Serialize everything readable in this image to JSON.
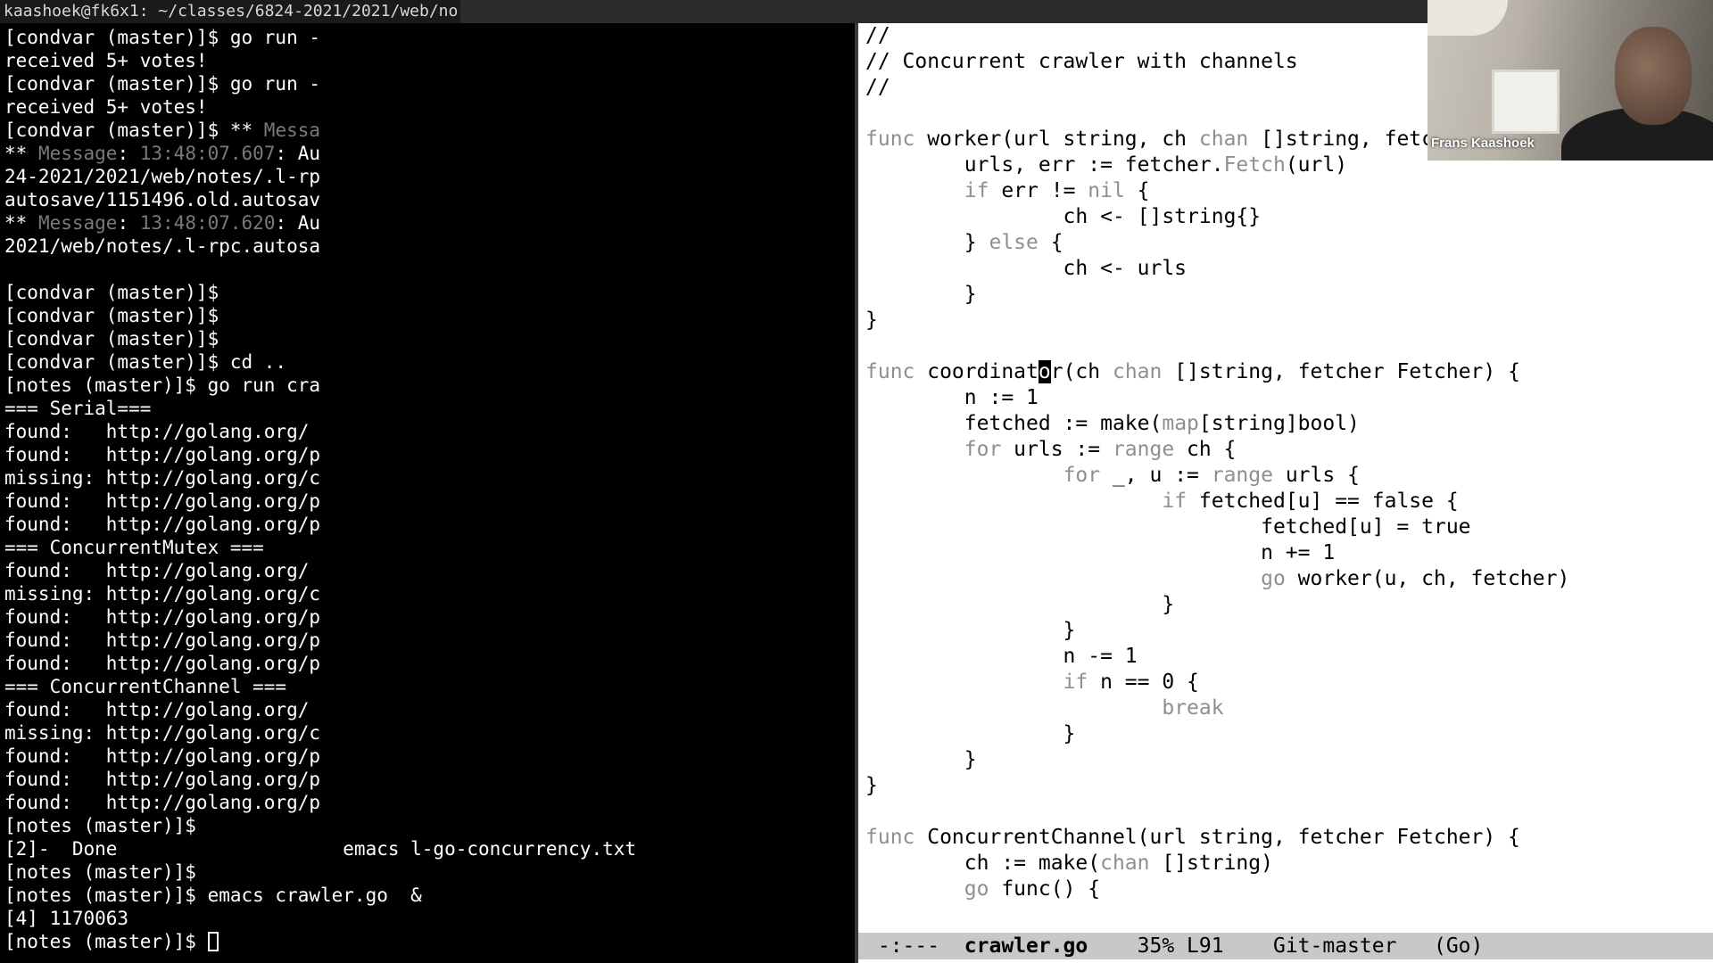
{
  "terminal": {
    "title": "kaashoek@fk6x1: ~/classes/6824-2021/2021/web/no",
    "lines": [
      [
        {
          "t": "[condvar (master)]$ go run -"
        }
      ],
      [
        {
          "t": "received 5+ votes!"
        }
      ],
      [
        {
          "t": "[condvar (master)]$ go run -"
        }
      ],
      [
        {
          "t": "received 5+ votes!"
        }
      ],
      [
        {
          "t": "[condvar (master)]$ ** "
        },
        {
          "t": "Messa",
          "c": "dim"
        }
      ],
      [
        {
          "t": "** "
        },
        {
          "t": "Message",
          "c": "dim"
        },
        {
          "t": ": "
        },
        {
          "t": "13:48:07.607",
          "c": "dim"
        },
        {
          "t": ": Au"
        }
      ],
      [
        {
          "t": "24-2021/2021/web/notes/.l-rp"
        }
      ],
      [
        {
          "t": "autosave/1151496.old.autosav"
        }
      ],
      [
        {
          "t": "** "
        },
        {
          "t": "Message",
          "c": "dim"
        },
        {
          "t": ": "
        },
        {
          "t": "13:48:07.620",
          "c": "dim"
        },
        {
          "t": ": Au"
        }
      ],
      [
        {
          "t": "2021/web/notes/.l-rpc.autosa"
        }
      ],
      [
        {
          "t": ""
        }
      ],
      [
        {
          "t": "[condvar (master)]$"
        }
      ],
      [
        {
          "t": "[condvar (master)]$"
        }
      ],
      [
        {
          "t": "[condvar (master)]$"
        }
      ],
      [
        {
          "t": "[condvar (master)]$ cd .."
        }
      ],
      [
        {
          "t": "[notes (master)]$ go run cra"
        }
      ],
      [
        {
          "t": "=== Serial==="
        }
      ],
      [
        {
          "t": "found:   http://golang.org/"
        }
      ],
      [
        {
          "t": "found:   http://golang.org/p"
        }
      ],
      [
        {
          "t": "missing: http://golang.org/c"
        }
      ],
      [
        {
          "t": "found:   http://golang.org/p"
        }
      ],
      [
        {
          "t": "found:   http://golang.org/p"
        }
      ],
      [
        {
          "t": "=== ConcurrentMutex ==="
        }
      ],
      [
        {
          "t": "found:   http://golang.org/"
        }
      ],
      [
        {
          "t": "missing: http://golang.org/c"
        }
      ],
      [
        {
          "t": "found:   http://golang.org/p"
        }
      ],
      [
        {
          "t": "found:   http://golang.org/p"
        }
      ],
      [
        {
          "t": "found:   http://golang.org/p"
        }
      ],
      [
        {
          "t": "=== ConcurrentChannel ==="
        }
      ],
      [
        {
          "t": "found:   http://golang.org/"
        }
      ],
      [
        {
          "t": "missing: http://golang.org/c"
        }
      ],
      [
        {
          "t": "found:   http://golang.org/p"
        }
      ],
      [
        {
          "t": "found:   http://golang.org/p"
        }
      ],
      [
        {
          "t": "found:   http://golang.org/p"
        }
      ],
      [
        {
          "t": "[notes (master)]$"
        }
      ],
      [
        {
          "t": "[2]-  Done                    emacs l-go-concurrency.txt"
        }
      ],
      [
        {
          "t": "[notes (master)]$"
        }
      ],
      [
        {
          "t": "[notes (master)]$ emacs crawler.go  &"
        }
      ],
      [
        {
          "t": "[4] 1170063"
        }
      ],
      [
        {
          "t": "[notes (master)]$ "
        }
      ]
    ]
  },
  "editor": {
    "lines": [
      [
        {
          "t": "//"
        }
      ],
      [
        {
          "t": "// Concurrent crawler with channels"
        }
      ],
      [
        {
          "t": "//"
        }
      ],
      [
        {
          "t": ""
        }
      ],
      [
        {
          "t": "func",
          "c": "kw"
        },
        {
          "t": " worker(url string, ch "
        },
        {
          "t": "chan",
          "c": "kw"
        },
        {
          "t": " []string, fetcher Fetcher) {"
        }
      ],
      [
        {
          "t": "        urls, err := fetcher."
        },
        {
          "t": "Fetch",
          "c": "kw"
        },
        {
          "t": "(url)"
        }
      ],
      [
        {
          "t": "        "
        },
        {
          "t": "if",
          "c": "kw"
        },
        {
          "t": " err != "
        },
        {
          "t": "nil",
          "c": "kw"
        },
        {
          "t": " {"
        }
      ],
      [
        {
          "t": "                ch <- []string{}"
        }
      ],
      [
        {
          "t": "        } "
        },
        {
          "t": "else",
          "c": "kw"
        },
        {
          "t": " {"
        }
      ],
      [
        {
          "t": "                ch <- urls"
        }
      ],
      [
        {
          "t": "        }"
        }
      ],
      [
        {
          "t": "}"
        }
      ],
      [
        {
          "t": ""
        }
      ],
      [
        {
          "t": "func",
          "c": "kw"
        },
        {
          "t": " coordinat"
        },
        {
          "t": "o",
          "c": "pointer"
        },
        {
          "t": "r(ch "
        },
        {
          "t": "chan",
          "c": "kw"
        },
        {
          "t": " []string, fetcher Fetcher) {"
        }
      ],
      [
        {
          "t": "        n := 1"
        }
      ],
      [
        {
          "t": "        fetched := make("
        },
        {
          "t": "map",
          "c": "kw"
        },
        {
          "t": "[string]bool)"
        }
      ],
      [
        {
          "t": "        "
        },
        {
          "t": "for",
          "c": "kw"
        },
        {
          "t": " urls := "
        },
        {
          "t": "range",
          "c": "kw"
        },
        {
          "t": " ch {"
        }
      ],
      [
        {
          "t": "                "
        },
        {
          "t": "for",
          "c": "kw"
        },
        {
          "t": " _, u := "
        },
        {
          "t": "range",
          "c": "kw"
        },
        {
          "t": " urls {"
        }
      ],
      [
        {
          "t": "                        "
        },
        {
          "t": "if",
          "c": "kw"
        },
        {
          "t": " fetched[u] == false {"
        }
      ],
      [
        {
          "t": "                                fetched[u] = true"
        }
      ],
      [
        {
          "t": "                                n += 1"
        }
      ],
      [
        {
          "t": "                                "
        },
        {
          "t": "go",
          "c": "kw"
        },
        {
          "t": " worker(u, ch, fetcher)"
        }
      ],
      [
        {
          "t": "                        }"
        }
      ],
      [
        {
          "t": "                }"
        }
      ],
      [
        {
          "t": "                n -= 1"
        }
      ],
      [
        {
          "t": "                "
        },
        {
          "t": "if",
          "c": "kw"
        },
        {
          "t": " n == 0 {"
        }
      ],
      [
        {
          "t": "                        "
        },
        {
          "t": "break",
          "c": "kw"
        }
      ],
      [
        {
          "t": "                }"
        }
      ],
      [
        {
          "t": "        }"
        }
      ],
      [
        {
          "t": "}"
        }
      ],
      [
        {
          "t": ""
        }
      ],
      [
        {
          "t": "func",
          "c": "kw"
        },
        {
          "t": " ConcurrentChannel(url string, fetcher Fetcher) {"
        }
      ],
      [
        {
          "t": "        ch := make("
        },
        {
          "t": "chan",
          "c": "kw"
        },
        {
          "t": " []string)"
        }
      ],
      [
        {
          "t": "        "
        },
        {
          "t": "go",
          "c": "kw"
        },
        {
          "t": " func() {"
        }
      ]
    ]
  },
  "modeline": {
    "status": " -:---  ",
    "buffer": "crawler.go",
    "position": "    35% L91    Git-master   (Go)"
  },
  "webcam": {
    "name": "Frans Kaashoek"
  }
}
